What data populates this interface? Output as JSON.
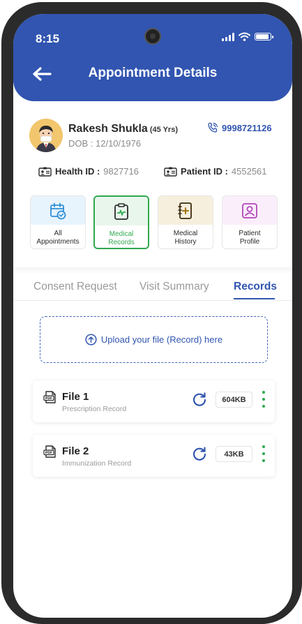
{
  "status_bar": {
    "time": "8:15"
  },
  "header": {
    "title": "Appointment Details",
    "back_icon": "arrow-left-icon"
  },
  "patient": {
    "name": "Rakesh Shukla",
    "age": "(45 Yrs)",
    "dob": "DOB : 12/10/1976",
    "phone": "9998721126",
    "health_id_label": "Health ID :",
    "health_id": "9827716",
    "patient_id_label": "Patient ID :",
    "patient_id": "4552561"
  },
  "tiles": [
    {
      "label": "All\nAppointments",
      "icon": "calendar-check-icon",
      "bg": "#e8f4fd",
      "color": "#2f8fd6"
    },
    {
      "label": "Medical\nRecords",
      "icon": "clipboard-pulse-icon",
      "bg": "#e9f6ec",
      "color": "#2fa84f"
    },
    {
      "label": "Medical\nHistory",
      "icon": "medical-book-icon",
      "bg": "#f7efde",
      "color": "#a0730d"
    },
    {
      "label": "Patient\nProfile",
      "icon": "profile-card-icon",
      "bg": "#fbeefb",
      "color": "#b246b8"
    }
  ],
  "tabs": [
    {
      "label": "Consent Request"
    },
    {
      "label": "Visit Summary"
    },
    {
      "label": "Records",
      "active": true
    }
  ],
  "upload": {
    "label": "Upload your file (Record) here"
  },
  "files": [
    {
      "name": "File 1",
      "type": "Prescription Record",
      "size": "604KB"
    },
    {
      "name": "File 2",
      "type": "Immunization Record",
      "size": "43KB"
    }
  ],
  "colors": {
    "primary": "#3155b0",
    "accent_green": "#2fa84f"
  }
}
